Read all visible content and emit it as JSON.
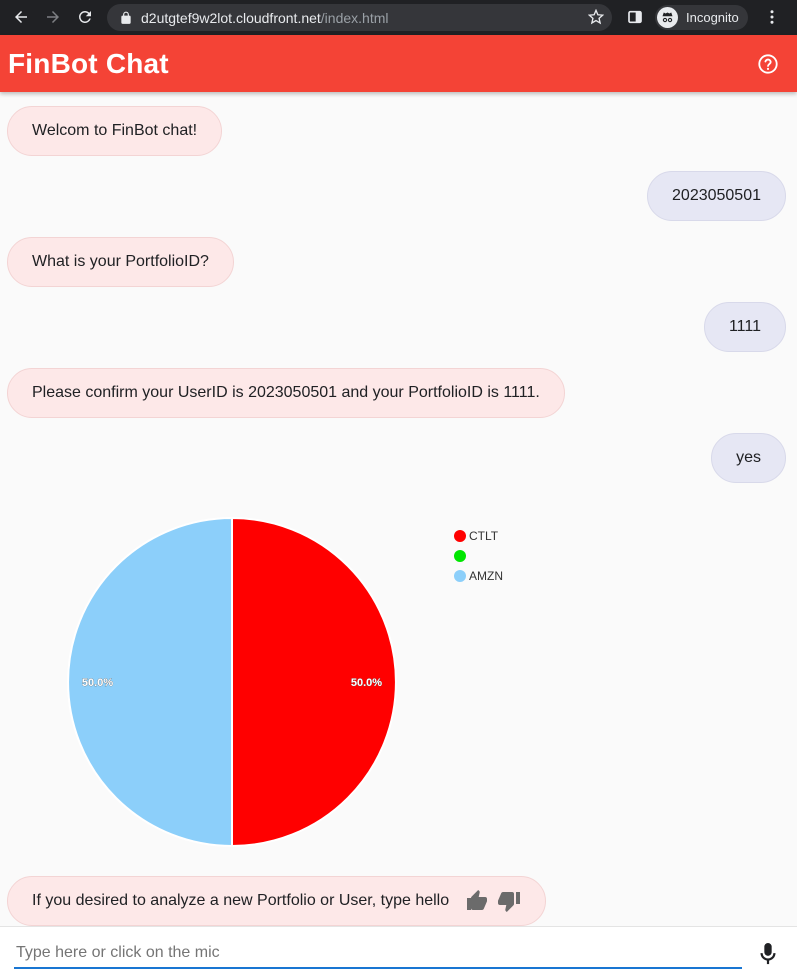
{
  "browser": {
    "url_host": "d2utgtef9w2lot.cloudfront.net",
    "url_path": "/index.html",
    "incognito_label": "Incognito"
  },
  "header": {
    "title": "FinBot Chat",
    "accent": "#f44336"
  },
  "messages": [
    {
      "from": "bot",
      "text": "Welcom to FinBot chat!"
    },
    {
      "from": "user",
      "text": "2023050501"
    },
    {
      "from": "bot",
      "text": "What is your PortfolioID?"
    },
    {
      "from": "user",
      "text": "1111"
    },
    {
      "from": "bot",
      "text": "Please confirm your UserID is 2023050501 and your PortfolioID is 1111."
    },
    {
      "from": "user",
      "text": "yes"
    },
    {
      "from": "bot",
      "text": "If you desired to analyze a new Portfolio or User, type hello"
    }
  ],
  "chart_data": {
    "type": "pie",
    "categories": [
      "CTLT",
      "",
      "AMZN"
    ],
    "values": [
      50.0,
      0.0,
      50.0
    ],
    "value_labels": [
      "50.0%",
      "",
      "50.0%"
    ],
    "colors": [
      "#ff0000",
      "#00e600",
      "#8ccffa"
    ],
    "legend": "top-right"
  },
  "input": {
    "placeholder": "Type here or click on the mic"
  }
}
